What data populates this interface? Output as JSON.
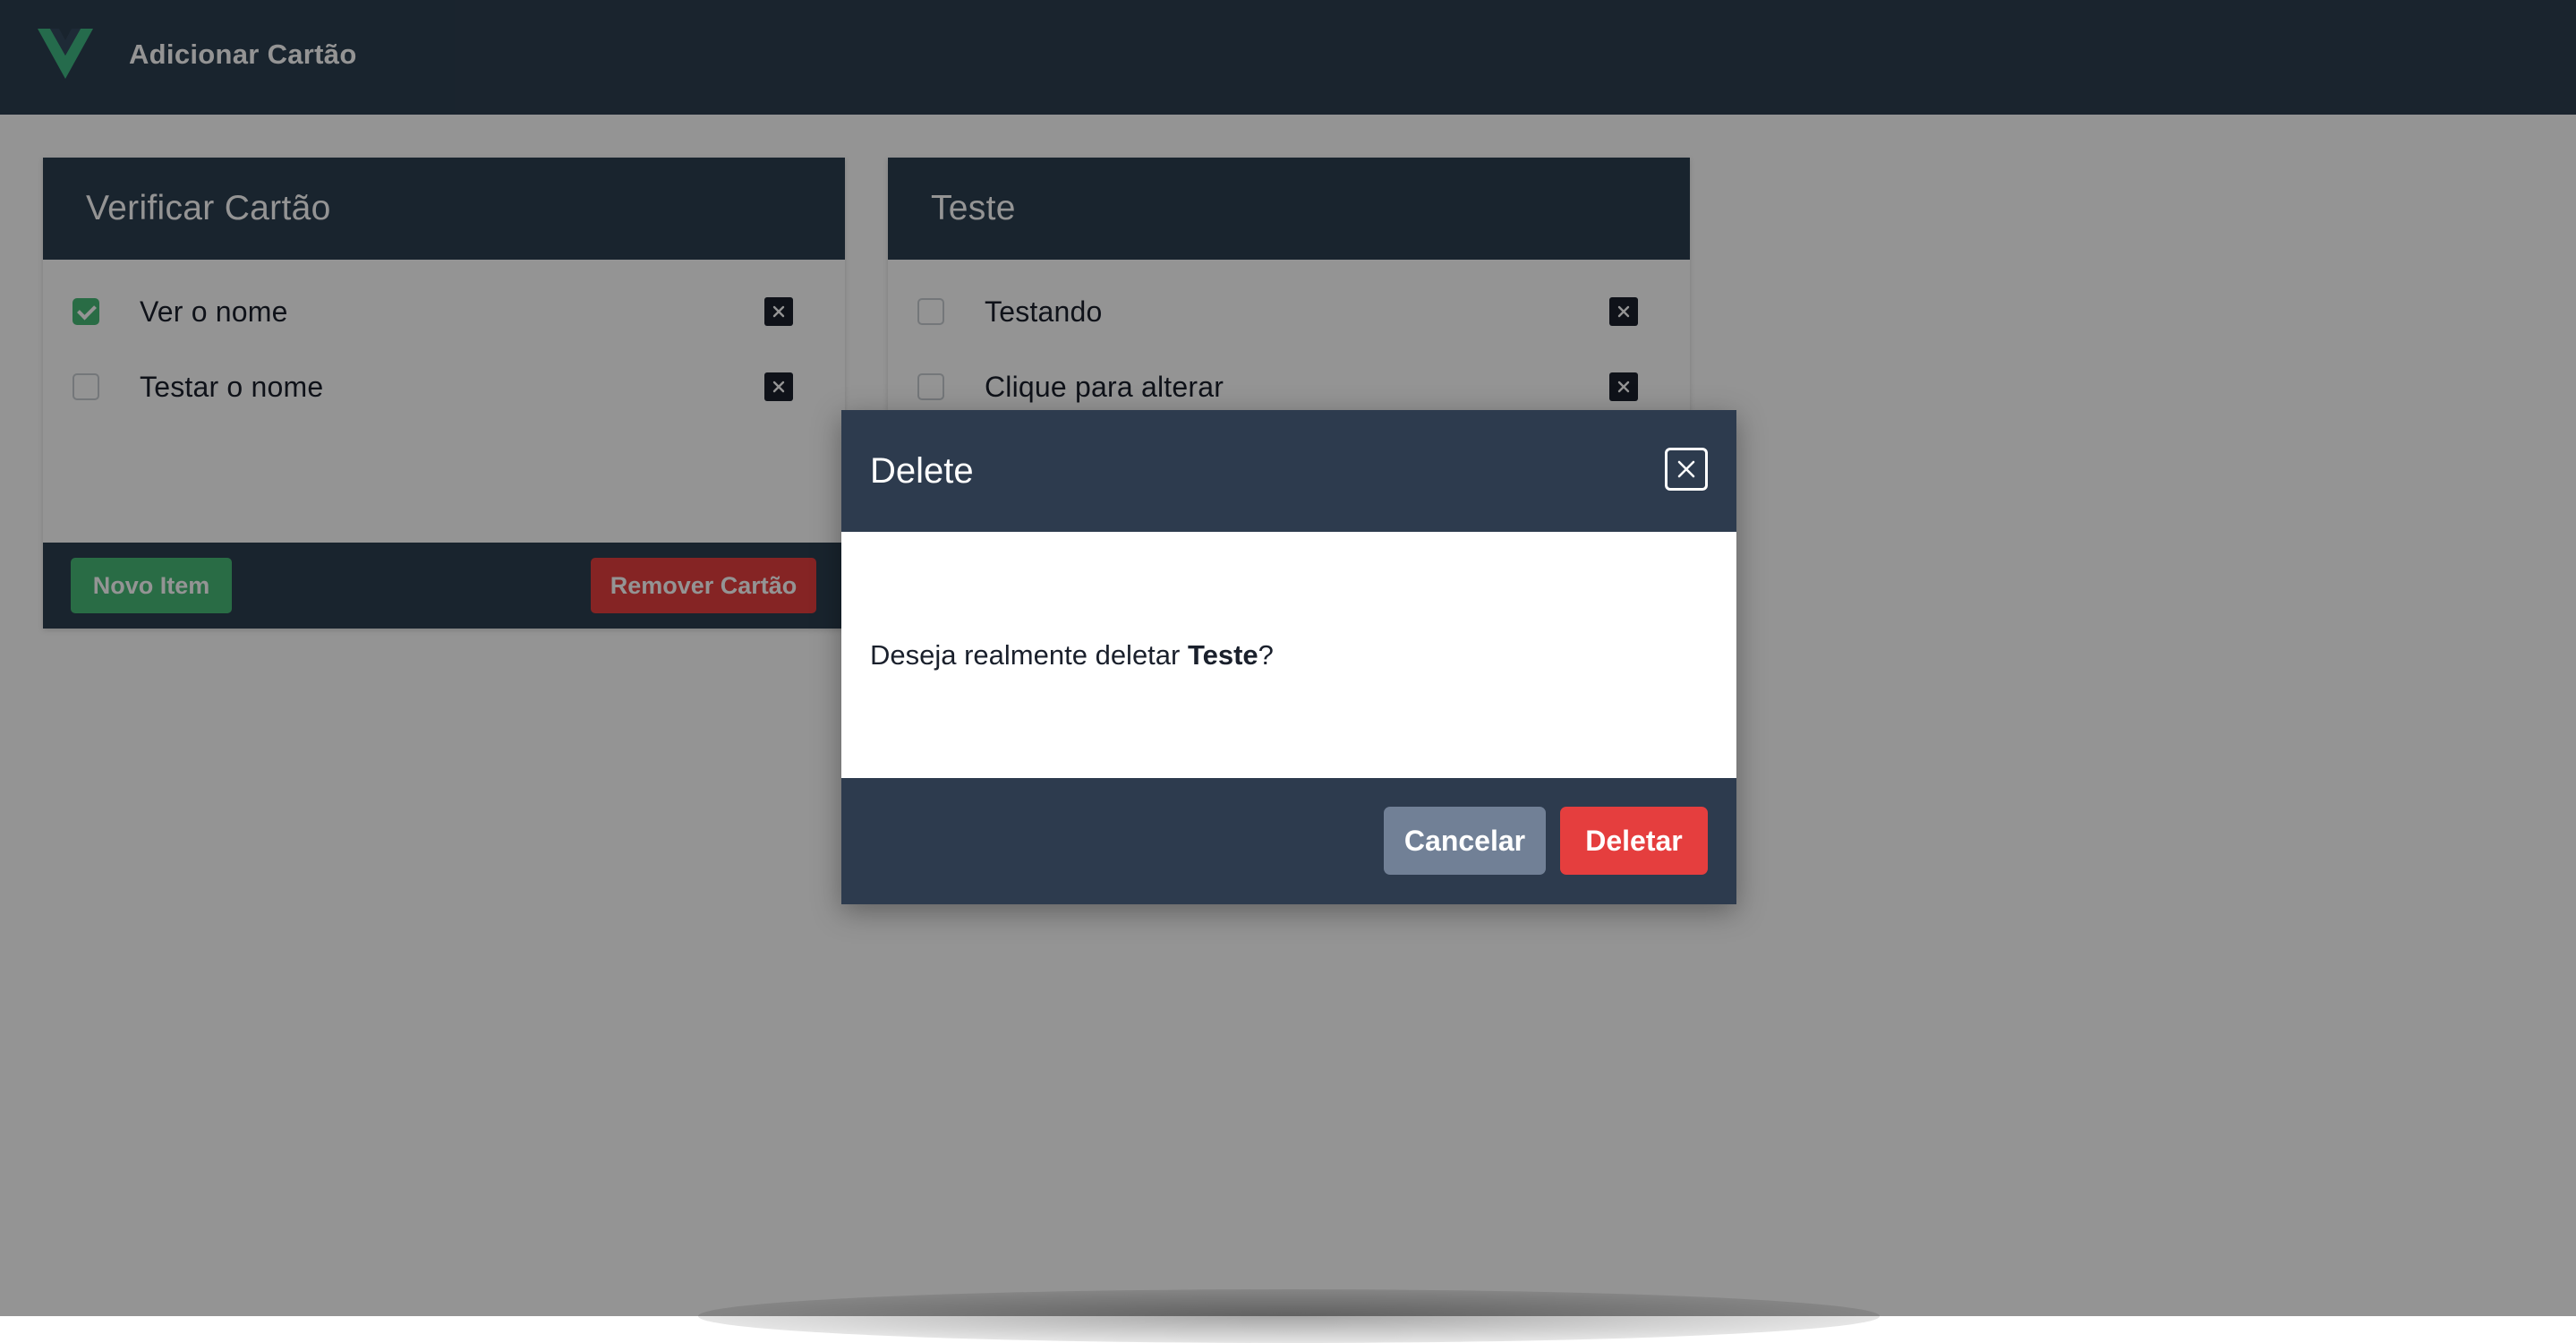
{
  "navbar": {
    "logo_icon": "vue-logo-icon",
    "add_card_label": "Adicionar Cartão"
  },
  "cards": [
    {
      "title": "Verificar Cartão",
      "items": [
        {
          "label": "Ver o nome",
          "checked": true
        },
        {
          "label": "Testar o nome",
          "checked": false
        }
      ],
      "new_item_label": "Novo Item",
      "remove_card_label": "Remover Cartão"
    },
    {
      "title": "Teste",
      "items": [
        {
          "label": "Testando",
          "checked": false
        },
        {
          "label": "Clique para alterar",
          "checked": false
        }
      ]
    }
  ],
  "modal": {
    "title": "Delete",
    "message_prefix": "Deseja realmente deletar ",
    "message_target": "Teste",
    "message_suffix": "?",
    "cancel_label": "Cancelar",
    "delete_label": "Deletar",
    "close_icon": "close-icon"
  },
  "colors": {
    "navy": "#2c3e50",
    "green": "#48bb78",
    "red": "#e53e3e",
    "gray": "#718096"
  }
}
